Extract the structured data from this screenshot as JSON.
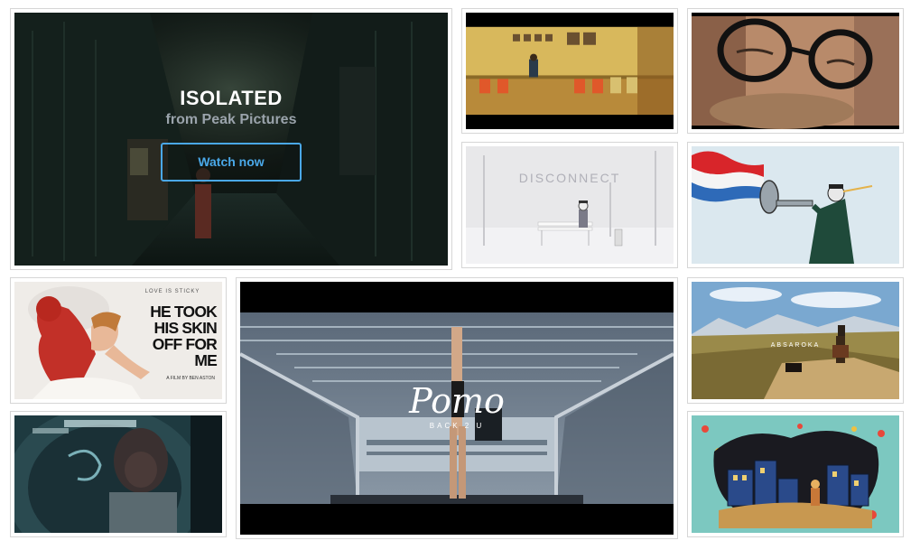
{
  "hero": {
    "title": "ISOLATED",
    "subtitle": "from Peak Pictures",
    "button_label": "Watch now"
  },
  "thumbs": {
    "disconnect_title": "DISCONNECT",
    "poster_tagline": "LOVE IS STICKY",
    "poster_headline": "HE TOOK HIS SKIN OFF FOR ME",
    "poster_credit": "A FILM BY BEN ASTON",
    "absaroka_title": "ABSAROKA",
    "pomo_title": "Pomo",
    "pomo_subtitle": "BACK 2 U"
  },
  "colors": {
    "accent": "#4aa8e8",
    "tile_border": "#d6d6d6"
  }
}
